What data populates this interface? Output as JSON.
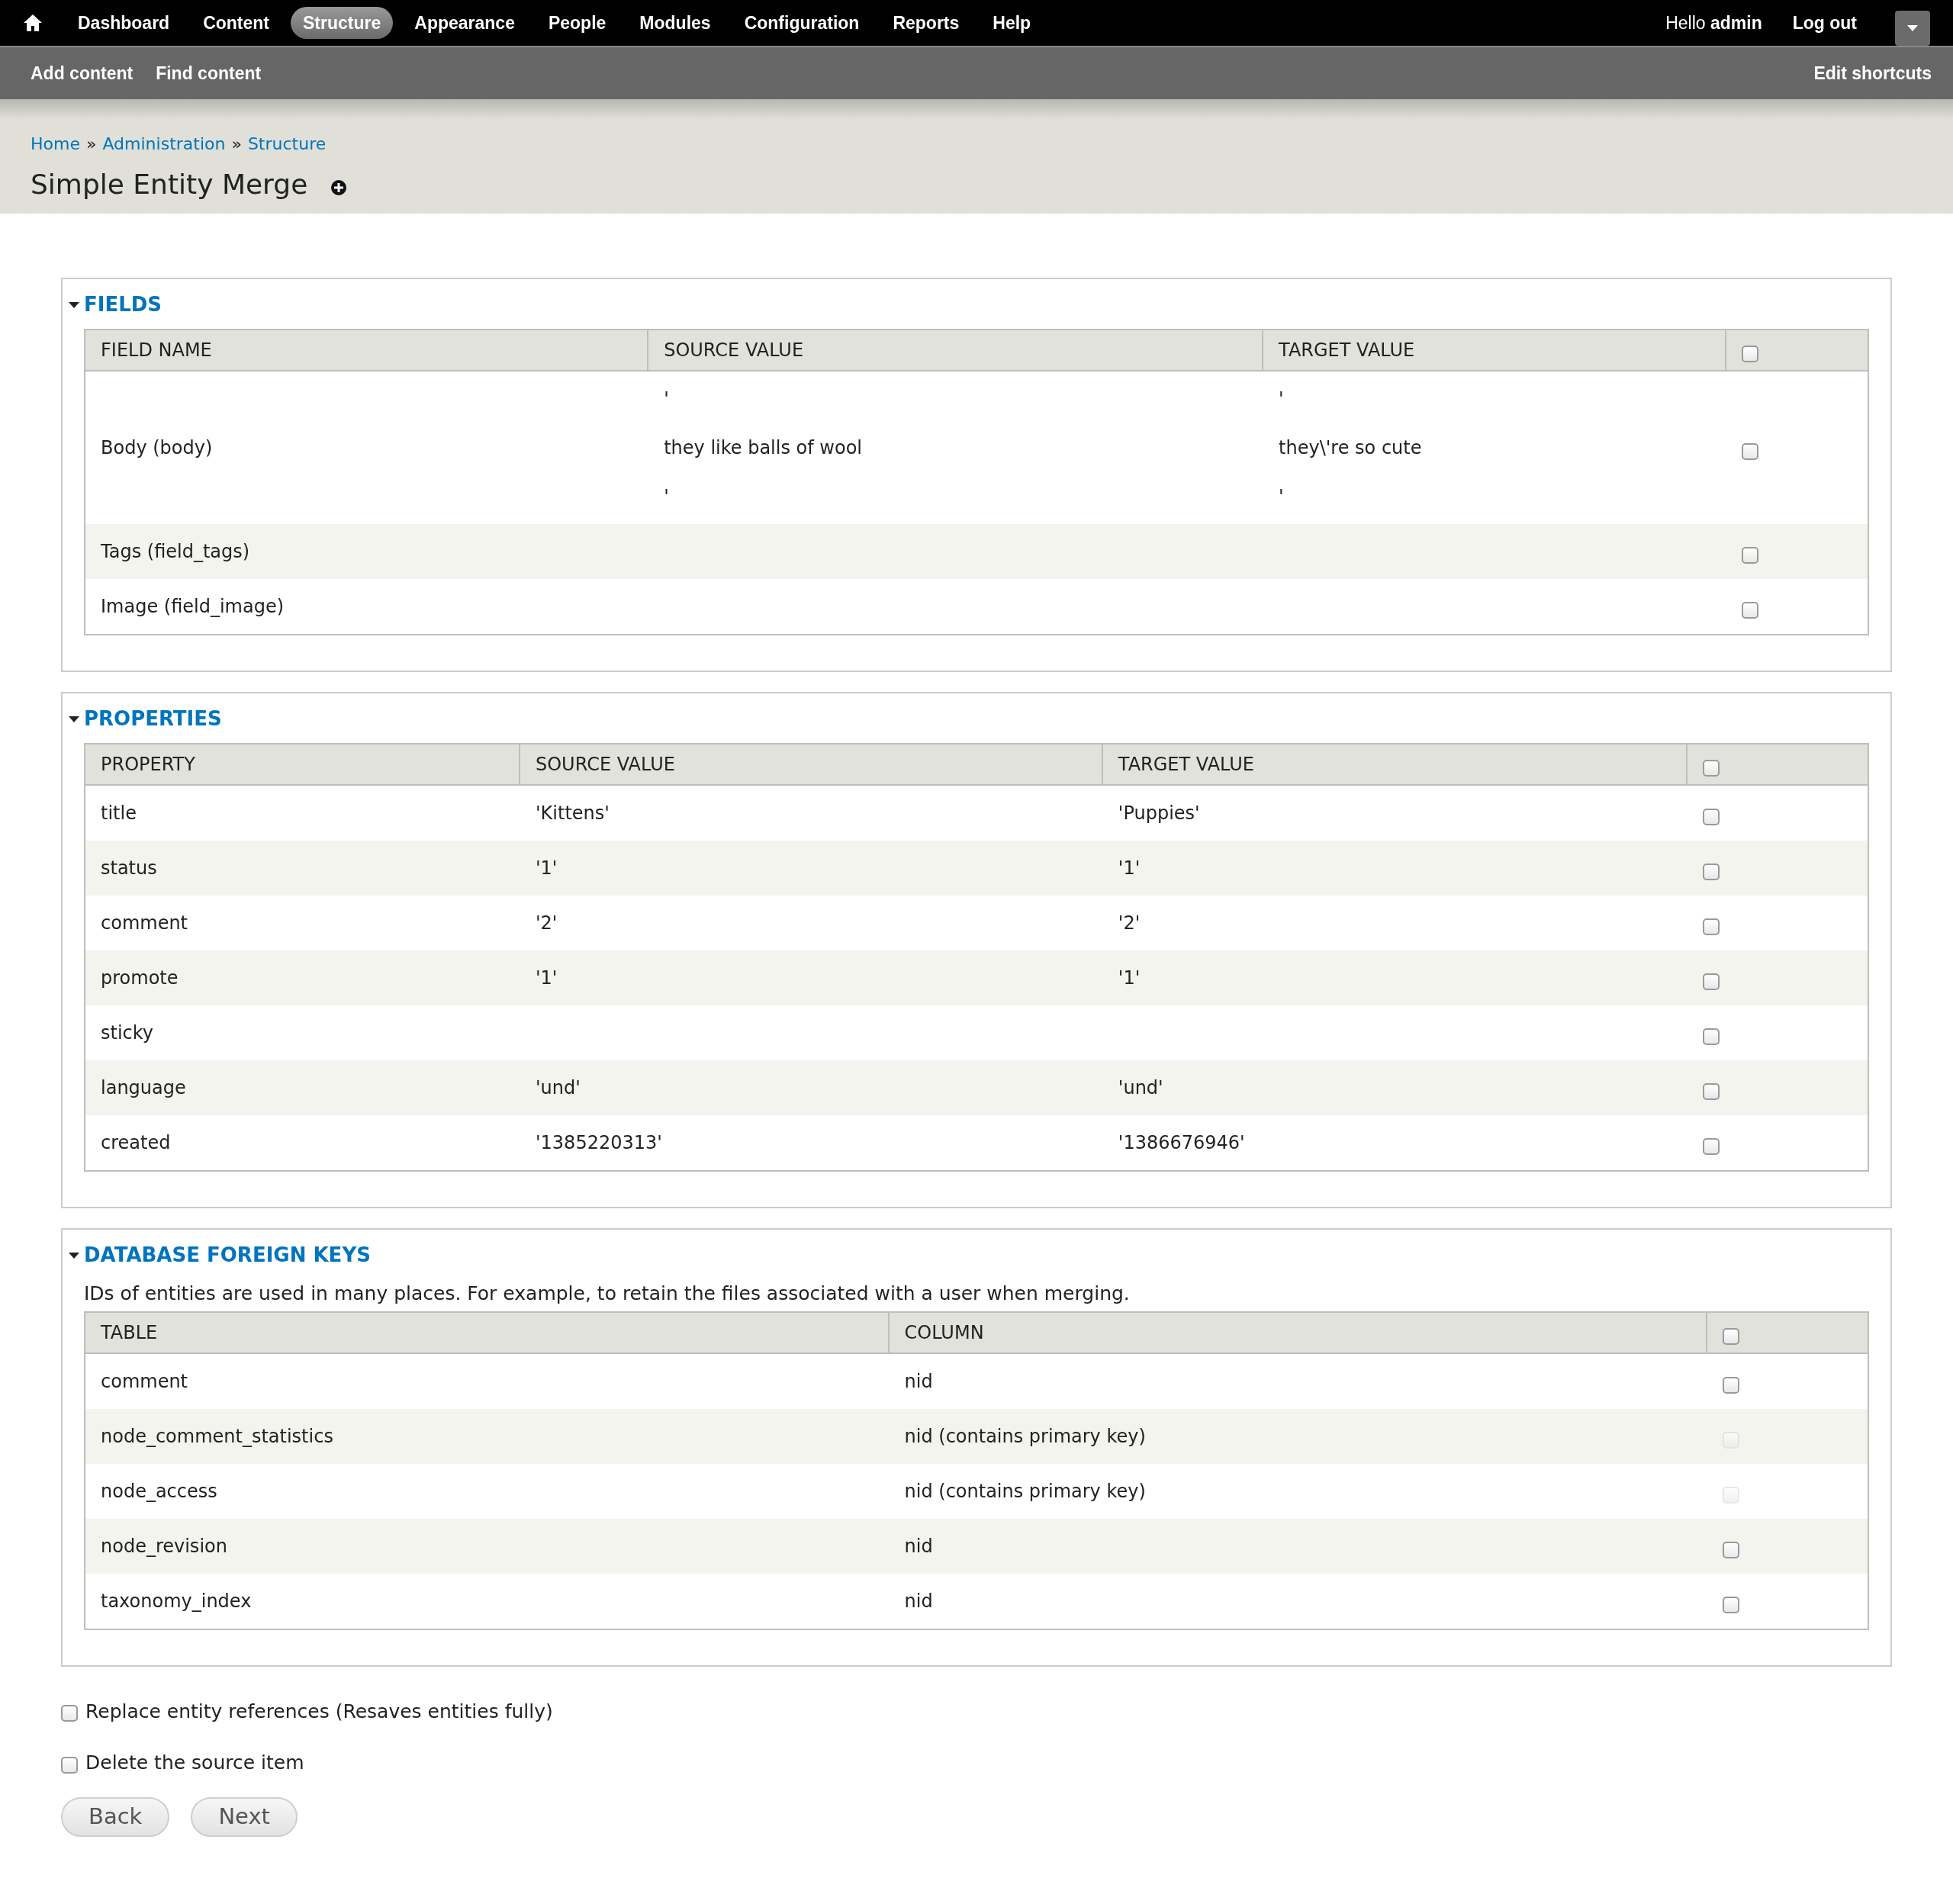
{
  "toolbar": {
    "menu": [
      {
        "label": "Dashboard",
        "selected": false
      },
      {
        "label": "Content",
        "selected": false
      },
      {
        "label": "Structure",
        "selected": true
      },
      {
        "label": "Appearance",
        "selected": false
      },
      {
        "label": "People",
        "selected": false
      },
      {
        "label": "Modules",
        "selected": false
      },
      {
        "label": "Configuration",
        "selected": false
      },
      {
        "label": "Reports",
        "selected": false
      },
      {
        "label": "Help",
        "selected": false
      }
    ],
    "greeting": "Hello **admin**",
    "logout": "Log out"
  },
  "shortcuts": {
    "items": [
      "Add content",
      "Find content"
    ],
    "edit": "Edit shortcuts"
  },
  "breadcrumb": {
    "separator": "»",
    "items": [
      "Home",
      "Administration",
      "Structure"
    ]
  },
  "title": "Simple Entity Merge",
  "fieldsets": [
    {
      "legend": "FIELDS",
      "expanded": true,
      "columns": [
        "FIELD NAME",
        "SOURCE VALUE",
        "TARGET VALUE"
      ],
      "select_all": {
        "checked": false
      },
      "rows": [
        {
          "cells": [
            "Body (body)",
            "'\n\nthey like balls of wool\n\n'",
            "'\n\nthey\\'re so cute\n\n'"
          ],
          "checked": false,
          "disabled": false
        },
        {
          "cells": [
            "Tags (field_tags)"
          ],
          "checked": false,
          "disabled": false
        },
        {
          "cells": [
            "Image (field_image)"
          ],
          "checked": false,
          "disabled": false
        }
      ]
    },
    {
      "legend": "PROPERTIES",
      "expanded": true,
      "columns": [
        "PROPERTY",
        "SOURCE VALUE",
        "TARGET VALUE"
      ],
      "select_all": {
        "checked": false
      },
      "rows": [
        {
          "cells": [
            "title",
            "'Kittens'",
            "'Puppies'"
          ],
          "checked": false,
          "disabled": false
        },
        {
          "cells": [
            "status",
            "'1'",
            "'1'"
          ],
          "checked": false,
          "disabled": false
        },
        {
          "cells": [
            "comment",
            "'2'",
            "'2'"
          ],
          "checked": false,
          "disabled": false
        },
        {
          "cells": [
            "promote",
            "'1'",
            "'1'"
          ],
          "checked": false,
          "disabled": false
        },
        {
          "cells": [
            "sticky"
          ],
          "checked": false,
          "disabled": false
        },
        {
          "cells": [
            "language",
            "'und'",
            "'und'"
          ],
          "checked": false,
          "disabled": false
        },
        {
          "cells": [
            "created",
            "'1385220313'",
            "'1386676946'"
          ],
          "checked": false,
          "disabled": false
        }
      ]
    },
    {
      "legend": "DATABASE FOREIGN KEYS",
      "expanded": true,
      "description": "IDs of entities are used in many places. For example, to retain the files associated with a user when merging.",
      "columns": [
        "TABLE",
        "COLUMN"
      ],
      "select_all": {
        "checked": false
      },
      "rows": [
        {
          "cells": [
            "comment",
            "nid"
          ],
          "checked": false,
          "disabled": false
        },
        {
          "cells": [
            "node_comment_statistics",
            "nid (contains primary key)"
          ],
          "checked": false,
          "disabled": true
        },
        {
          "cells": [
            "node_access",
            "nid (contains primary key)"
          ],
          "checked": false,
          "disabled": true
        },
        {
          "cells": [
            "node_revision",
            "nid"
          ],
          "checked": false,
          "disabled": false
        },
        {
          "cells": [
            "taxonomy_index",
            "nid"
          ],
          "checked": false,
          "disabled": false
        }
      ]
    }
  ],
  "options": [
    {
      "label": "Replace entity references (Resaves entities fully)",
      "checked": false
    },
    {
      "label": "Delete the source item",
      "checked": false
    }
  ],
  "buttons": [
    "Back",
    "Next"
  ]
}
